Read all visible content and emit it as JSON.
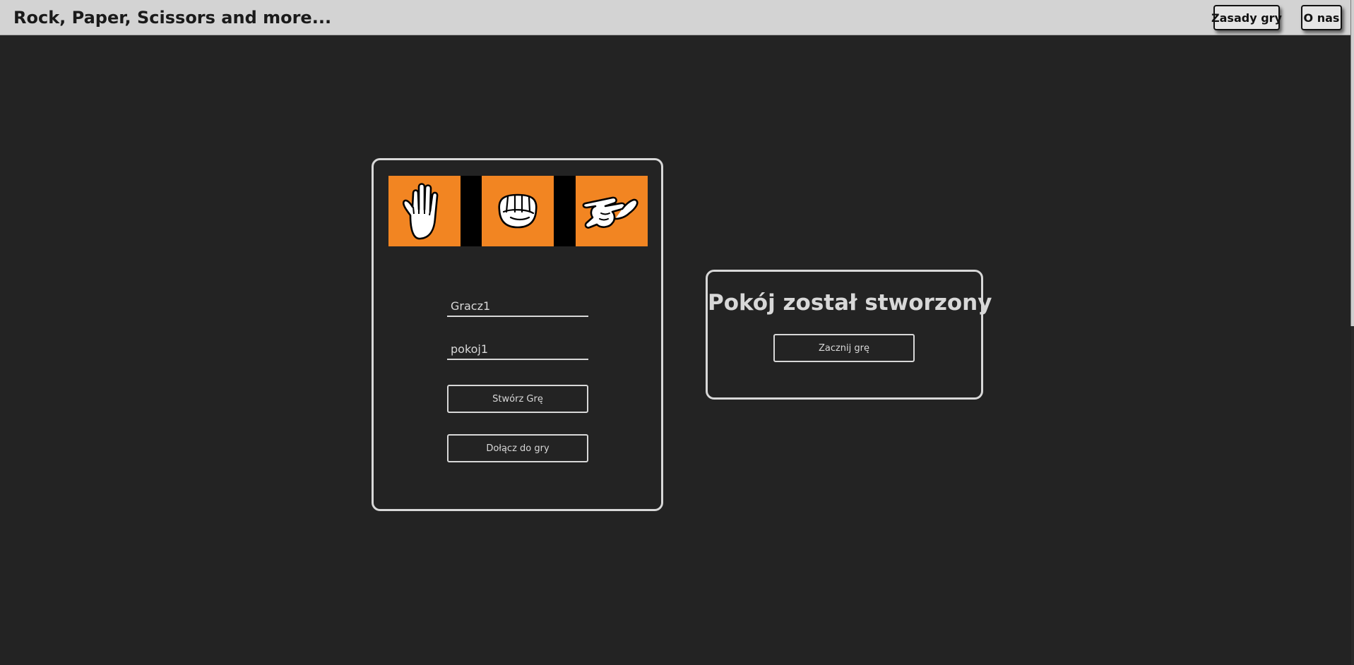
{
  "header": {
    "title": "Rock, Paper, Scissors and more...",
    "rules_label": "Zasady gry",
    "about_label": "O nas"
  },
  "choices": [
    {
      "name": "paper",
      "icon": "open-hand-icon"
    },
    {
      "name": "rock",
      "icon": "fist-icon"
    },
    {
      "name": "scissors",
      "icon": "scissors-hand-icon"
    }
  ],
  "form": {
    "player_name_value": "Gracz1",
    "room_name_value": "pokoj1",
    "create_label": "Stwórz Grę",
    "join_label": "Dołącz do gry"
  },
  "room": {
    "title": "Pokój został stworzony",
    "start_label": "Zacznij grę"
  },
  "colors": {
    "background": "#232323",
    "header": "#d3d3d3",
    "accent": "#f28522",
    "foreground": "#d8d8d8"
  }
}
